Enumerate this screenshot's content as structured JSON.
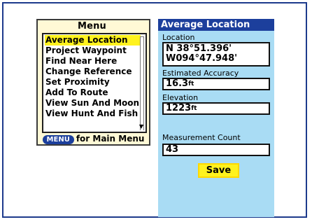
{
  "menu": {
    "title": "Menu",
    "items": [
      "Average Location",
      "Project Waypoint",
      "Find Near Here",
      "Change Reference",
      "Set Proximity",
      "Add To Route",
      "View Sun And Moon",
      "View Hunt And Fish"
    ],
    "selected_item": "Average Location",
    "footer_key": "MENU",
    "footer_text": "for Main Menu"
  },
  "average_location": {
    "title": "Average Location",
    "location_label": "Location",
    "latitude": "N  38°51.396'",
    "longitude": "W094°47.948'",
    "accuracy_label": "Estimated Accuracy",
    "accuracy_value": "16.3",
    "accuracy_unit": "ft",
    "elevation_label": "Elevation",
    "elevation_value": "1223",
    "elevation_unit": "ft",
    "count_label": "Measurement Count",
    "count_value": "43",
    "save_label": "Save"
  },
  "colors": {
    "title_bar": "#1c3f9c",
    "highlight": "#fff21e",
    "panel_background": "#a9dcf4",
    "menu_background": "#fff9d6"
  }
}
